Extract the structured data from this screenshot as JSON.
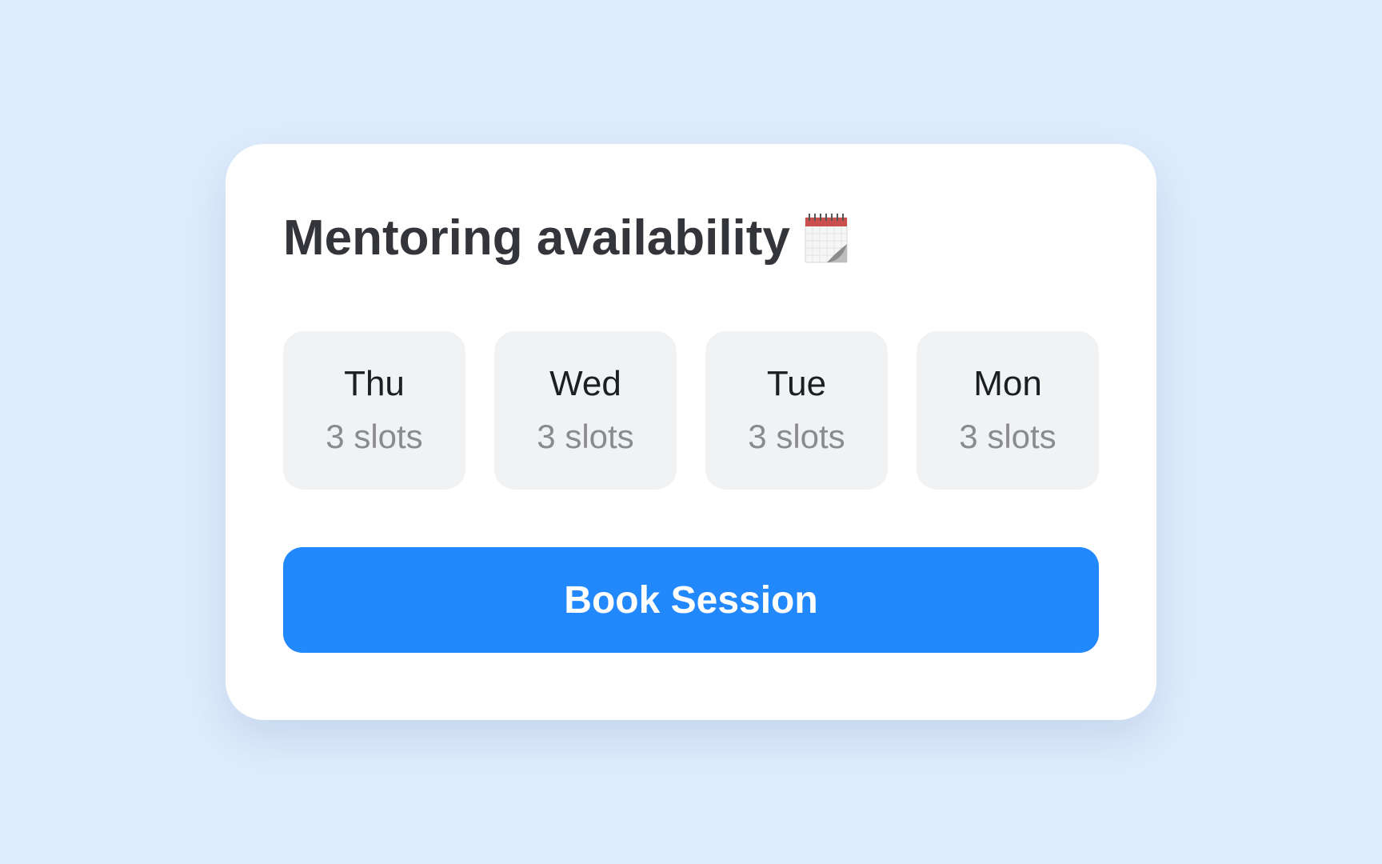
{
  "card": {
    "title": "Mentoring availability",
    "title_icon": "calendar-icon"
  },
  "days": [
    {
      "name": "Thu",
      "slots": "3 slots"
    },
    {
      "name": "Wed",
      "slots": "3 slots"
    },
    {
      "name": "Tue",
      "slots": "3 slots"
    },
    {
      "name": "Mon",
      "slots": "3 slots"
    }
  ],
  "actions": {
    "book_label": "Book Session"
  },
  "colors": {
    "background": "#dfecfc",
    "card": "#ffffff",
    "day_tile": "#f1f2f4",
    "accent": "#2288fe",
    "title_text": "#34353b",
    "muted_text": "#8a8b8f"
  }
}
